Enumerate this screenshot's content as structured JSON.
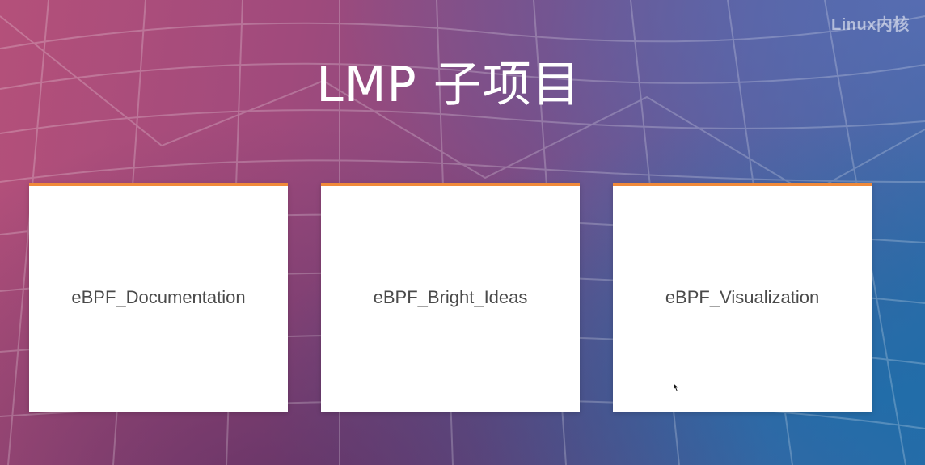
{
  "watermark": "Linux内核",
  "slide": {
    "title": "LMP 子项目"
  },
  "cards": [
    {
      "label": "eBPF_Documentation"
    },
    {
      "label": "eBPF_Bright_Ideas"
    },
    {
      "label": "eBPF_Visualization"
    }
  ],
  "colors": {
    "card_accent": "#f08a3a",
    "card_background": "#ffffff",
    "title_text": "#ffffff",
    "background_left": "#b4507a",
    "background_right": "#2f6aa6"
  },
  "icons": {
    "cursor": "mouse-pointer-icon"
  }
}
